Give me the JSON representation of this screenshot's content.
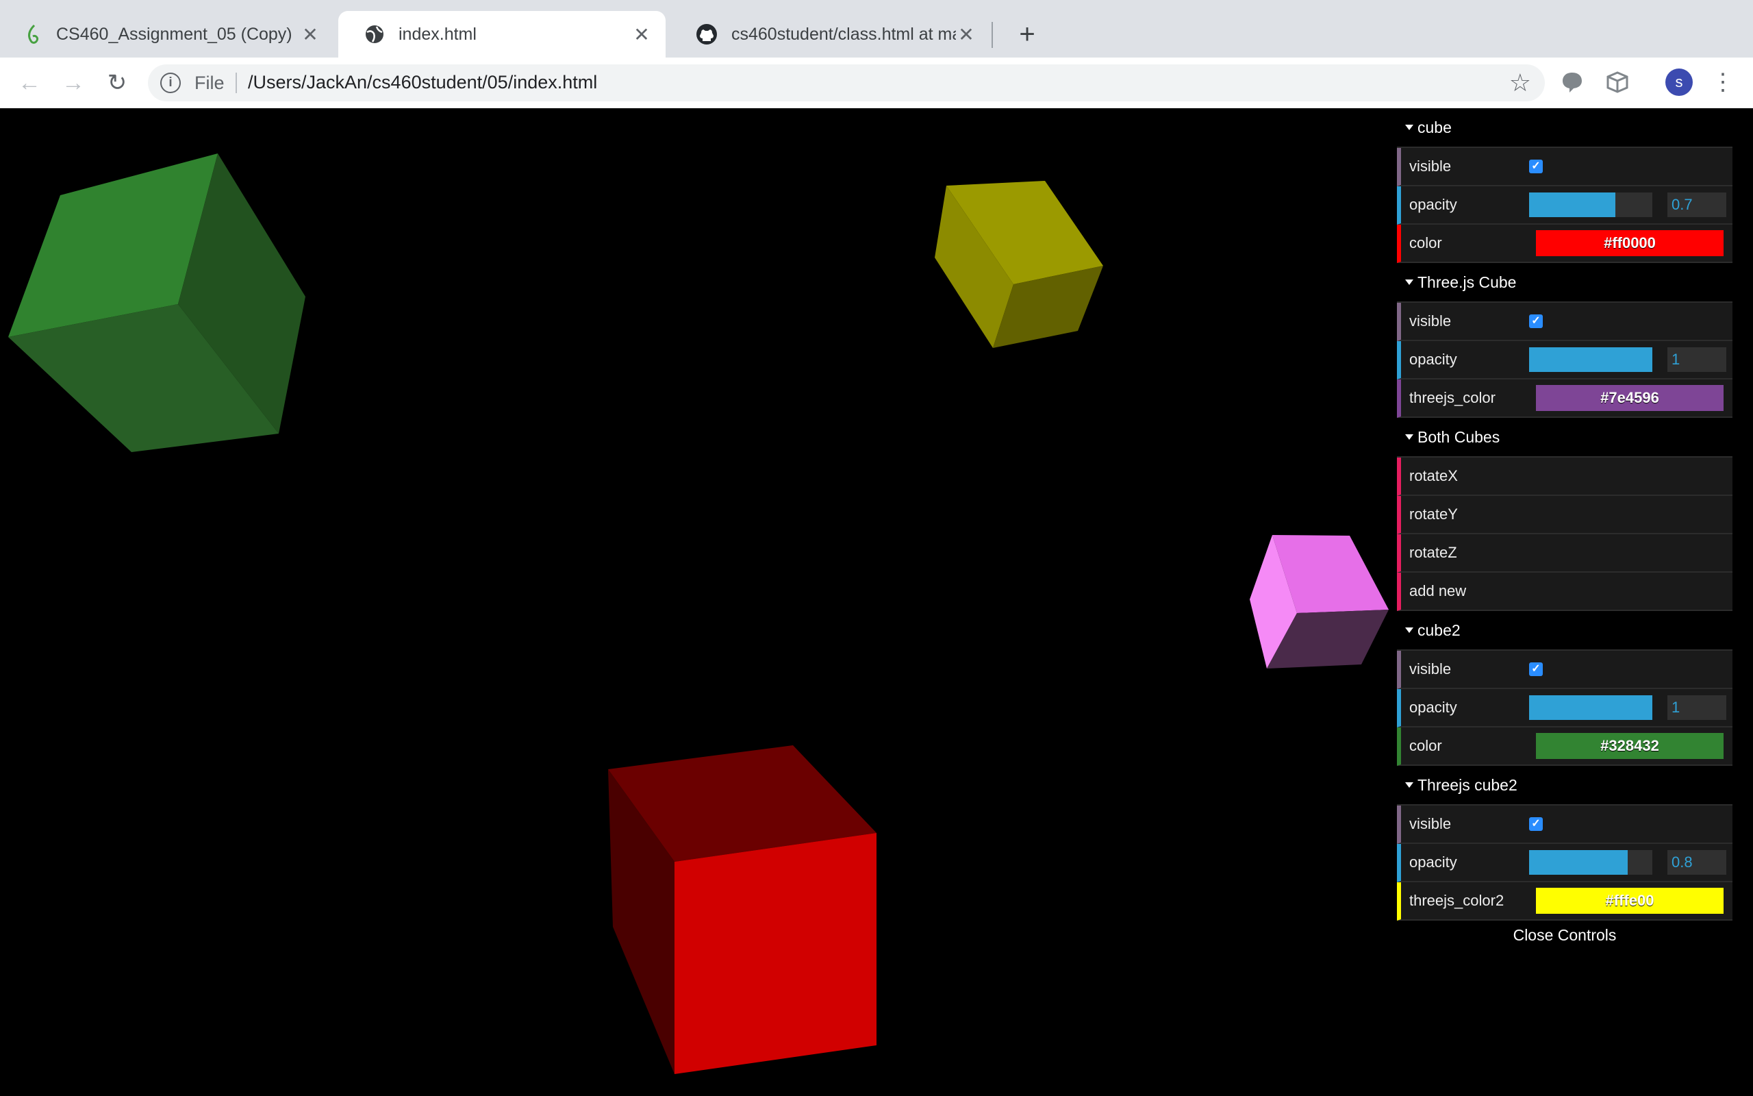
{
  "tabs": [
    {
      "title": "CS460_Assignment_05 (Copy)",
      "icon": "overleaf-leaf-icon"
    },
    {
      "title": "index.html",
      "icon": "globe-icon"
    },
    {
      "title": "cs460student/class.html at ma",
      "icon": "github-icon"
    }
  ],
  "toolbar": {
    "scheme": "File",
    "url": "/Users/JackAn/cs460student/05/index.html",
    "avatar_initial": "s"
  },
  "gui": {
    "folders": [
      {
        "title": "cube",
        "rows": [
          {
            "type": "bool",
            "label": "visible",
            "checked": true
          },
          {
            "type": "num",
            "label": "opacity",
            "value": "0.7",
            "fraction": 0.7
          },
          {
            "type": "color",
            "label": "color",
            "value": "#ff0000",
            "color": "#ff0000",
            "text_color": "#ffffff"
          }
        ]
      },
      {
        "title": "Three.js Cube",
        "rows": [
          {
            "type": "bool",
            "label": "visible",
            "checked": true
          },
          {
            "type": "num",
            "label": "opacity",
            "value": "1",
            "fraction": 1
          },
          {
            "type": "color",
            "label": "threejs_color",
            "value": "#7e4596",
            "color": "#7e4596",
            "text_color": "#ffffff"
          }
        ]
      },
      {
        "title": "Both Cubes",
        "rows": [
          {
            "type": "fn",
            "label": "rotateX"
          },
          {
            "type": "fn",
            "label": "rotateY"
          },
          {
            "type": "fn",
            "label": "rotateZ"
          },
          {
            "type": "fn",
            "label": "add new"
          }
        ]
      },
      {
        "title": "cube2",
        "rows": [
          {
            "type": "bool",
            "label": "visible",
            "checked": true
          },
          {
            "type": "num",
            "label": "opacity",
            "value": "1",
            "fraction": 1
          },
          {
            "type": "color",
            "label": "color",
            "value": "#328432",
            "color": "#328432",
            "text_color": "#ffffff"
          }
        ]
      },
      {
        "title": "Threejs cube2",
        "rows": [
          {
            "type": "bool",
            "label": "visible",
            "checked": true
          },
          {
            "type": "num",
            "label": "opacity",
            "value": "0.8",
            "fraction": 0.8
          },
          {
            "type": "color",
            "label": "threejs_color2",
            "value": "#fffe00",
            "color": "#fffe00",
            "text_color": "#ffffff"
          }
        ]
      }
    ],
    "close_label": "Close Controls"
  }
}
